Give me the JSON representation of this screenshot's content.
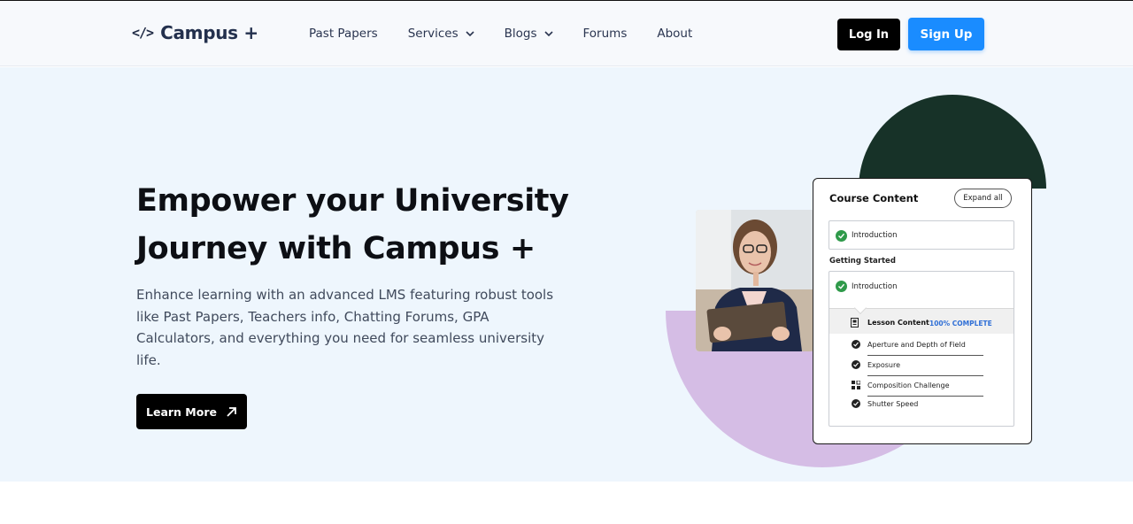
{
  "header": {
    "logo_icon": "</>",
    "logo_text": "Campus +",
    "nav": [
      {
        "label": "Past Papers",
        "dropdown": false
      },
      {
        "label": "Services",
        "dropdown": true
      },
      {
        "label": "Blogs",
        "dropdown": true
      },
      {
        "label": "Forums",
        "dropdown": false
      },
      {
        "label": "About",
        "dropdown": false
      }
    ],
    "login_label": "Log In",
    "signup_label": "Sign Up"
  },
  "hero": {
    "title_line1": "Empower your University",
    "title_line2": "Journey with Campus +",
    "description": "Enhance learning with an advanced LMS featuring robust tools like Past Papers, Teachers info, Chatting Forums, GPA Calculators, and everything you need for seamless university life.",
    "learn_more_label": "Learn More"
  },
  "course_card": {
    "title": "Course Content",
    "expand_label": "Expand all",
    "first_item": "Introduction",
    "group_label": "Getting Started",
    "group_item": "Introduction",
    "lesson_label": "Lesson Content",
    "lesson_progress": "100% COMPLETE",
    "sub_items": [
      {
        "label": "Aperture and Depth of Field",
        "icon": "check-circle-icon"
      },
      {
        "label": "Exposure",
        "icon": "check-circle-icon"
      },
      {
        "label": "Composition Challenge",
        "icon": "grid-icon"
      },
      {
        "label": "Shutter Speed",
        "icon": "check-circle-icon"
      }
    ]
  },
  "colors": {
    "primary_blue": "#1a8cff",
    "dark_green": "#173228",
    "lavender": "#d5bde5",
    "hero_bg": "#eef6fd"
  }
}
